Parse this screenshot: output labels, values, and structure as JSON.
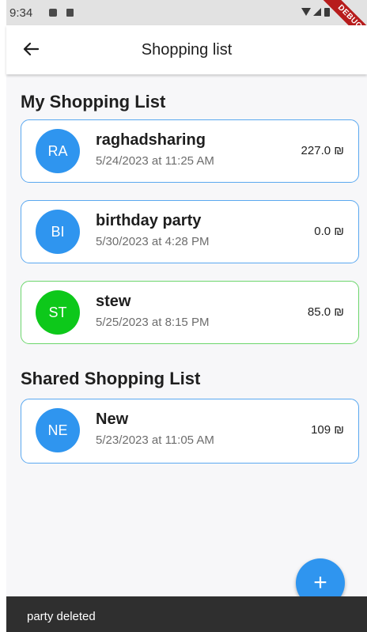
{
  "status_bar": {
    "time": "9:34",
    "debug_label": "DEBUG"
  },
  "app_bar": {
    "title": "Shopping list",
    "back_icon": "arrow-back-icon"
  },
  "sections": {
    "my": {
      "title": "My Shopping List",
      "items": [
        {
          "initials": "RA",
          "name": "raghadsharing",
          "date": "5/24/2023 at 11:25 AM",
          "amount": "227.0 ₪",
          "color": "#2f95ef"
        },
        {
          "initials": "BI",
          "name": "birthday party",
          "date": "5/30/2023 at 4:28 PM",
          "amount": "0.0 ₪",
          "color": "#2f95ef"
        },
        {
          "initials": "ST",
          "name": "stew",
          "date": "5/25/2023 at 8:15 PM",
          "amount": "85.0 ₪",
          "color": "#0dc81a"
        }
      ]
    },
    "shared": {
      "title": "Shared Shopping List",
      "items": [
        {
          "initials": "NE",
          "name": "New",
          "date": "5/23/2023 at 11:05 AM",
          "amount": "109 ₪",
          "color": "#2f95ef"
        }
      ]
    }
  },
  "fab": {
    "icon": "plus-icon",
    "label": "+"
  },
  "snackbar": {
    "message": "party  deleted"
  }
}
